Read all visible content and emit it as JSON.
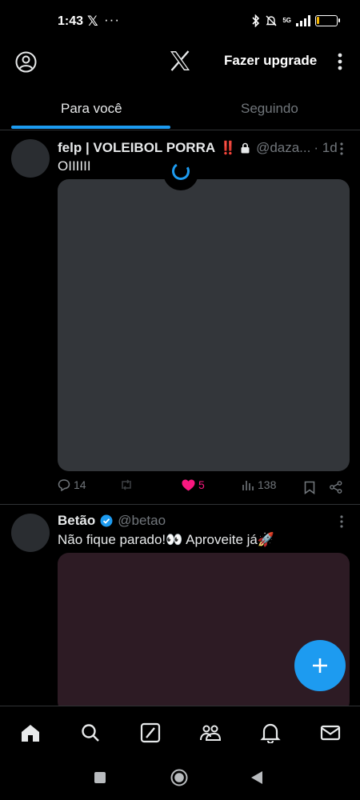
{
  "status_bar": {
    "time": "1:43",
    "x_indicator": "𝕏",
    "more_indicator": "···",
    "network": "5G",
    "battery_level": "2",
    "battery_fraction": 0.12
  },
  "top_bar": {
    "upgrade_label": "Fazer upgrade",
    "icons": [
      "profile-icon",
      "x-logo-icon",
      "more-vertical-icon"
    ]
  },
  "tabs": [
    {
      "label": "Para você",
      "active": true
    },
    {
      "label": "Seguindo",
      "active": false
    }
  ],
  "posts": [
    {
      "name": "felp | VOLEIBOL PORRA",
      "name_badge": "‼️",
      "locked": true,
      "handle": "@daza...",
      "time": "· 1d",
      "text": "OIIIIII",
      "replies": "14",
      "likes": "5",
      "views": "138"
    },
    {
      "name": "Betão",
      "verified": true,
      "handle": "@betao",
      "text": "Não fique parado!👀 Aproveite já🚀"
    }
  ],
  "colors": {
    "accent": "#1d9bf0",
    "like": "#f91880",
    "muted": "#71767b",
    "background": "#000000"
  },
  "bottom_nav": [
    "home-icon",
    "search-icon",
    "grok-icon",
    "communities-icon",
    "notifications-icon",
    "messages-icon"
  ],
  "system_nav": [
    "recents-button",
    "home-button",
    "back-button"
  ]
}
